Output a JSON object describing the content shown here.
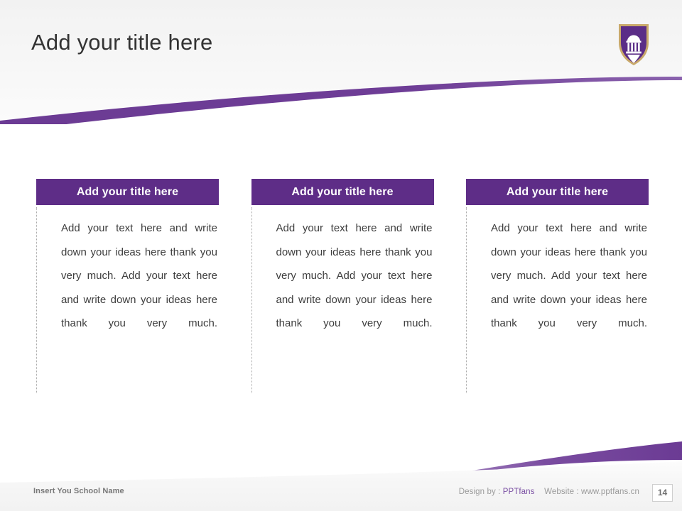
{
  "slide": {
    "title": "Add your title here",
    "page_number": "14",
    "accent_purple": "#5E2D87",
    "swoosh_purple": "#6B3B94",
    "shield_gold": "#C9A96A",
    "title_color": "#333333",
    "body_text_color": "#3D3D3D"
  },
  "logo": {
    "name": "university-shield-logo",
    "description": "Purple shield with gold border containing white chapel cupola and cross"
  },
  "columns": [
    {
      "header": "Add your title here",
      "body": "Add your text here and write down your ideas here thank you very much. Add your text here and write down your ideas here thank you very much."
    },
    {
      "header": "Add your title here",
      "body": "Add your text here and write down your ideas here thank you very much. Add your text here and write down your ideas here thank you very much."
    },
    {
      "header": "Add your title here",
      "body": "Add your text here and write down your ideas here thank you very much. Add your text here and write down your ideas here thank you very much."
    }
  ],
  "footer": {
    "school_name": "Insert You School Name",
    "design_by_label": "Design by :",
    "design_by_value": "PPTfans",
    "website_label": "Website :",
    "website_value": "www.pptfans.cn"
  }
}
